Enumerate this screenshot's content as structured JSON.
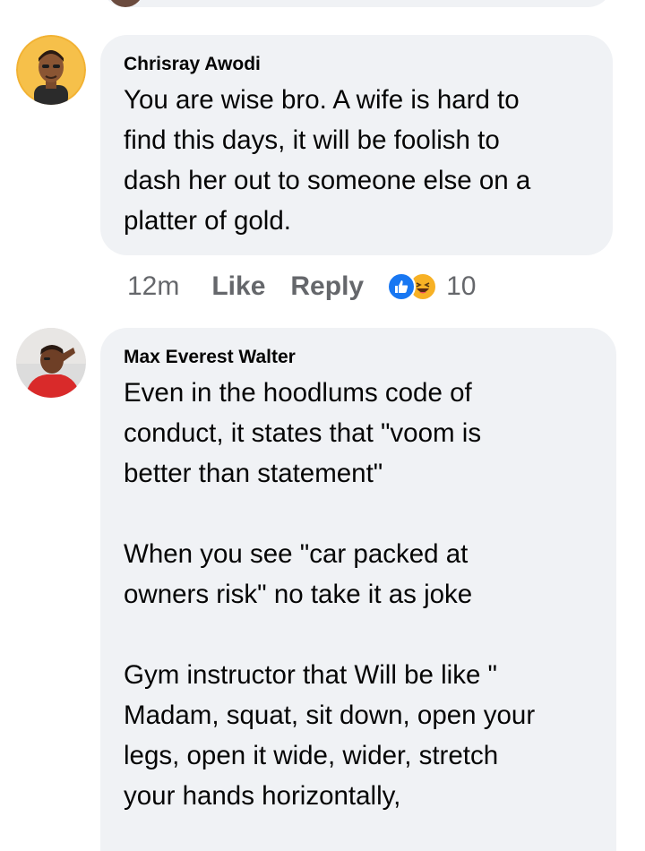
{
  "comments": [
    {
      "author": "Chrisray Awodi",
      "text": "You are wise bro. A wife is hard to\nfind this days, it will be foolish to\ndash her out to someone else on a\nplatter of gold.",
      "time": "12m",
      "like_label": "Like",
      "reply_label": "Reply",
      "reaction_count": "10",
      "reactions": [
        "like-icon",
        "haha-icon"
      ]
    },
    {
      "author": "Max Everest Walter",
      "text": "Even in the hoodlums code of\nconduct, it states that \"voom is\nbetter than statement\"\n\nWhen you see \"car packed at\nowners risk\" no take it as joke\n\nGym instructor that Will be like \"\nMadam, squat, sit down, open your\nlegs, open it wide, wider, stretch\nyour hands horizontally,"
    }
  ],
  "colors": {
    "bubble": "#f0f2f5",
    "meta_text": "#65676b",
    "like_blue": "#1877f2",
    "haha_yellow": "#f7b125"
  }
}
